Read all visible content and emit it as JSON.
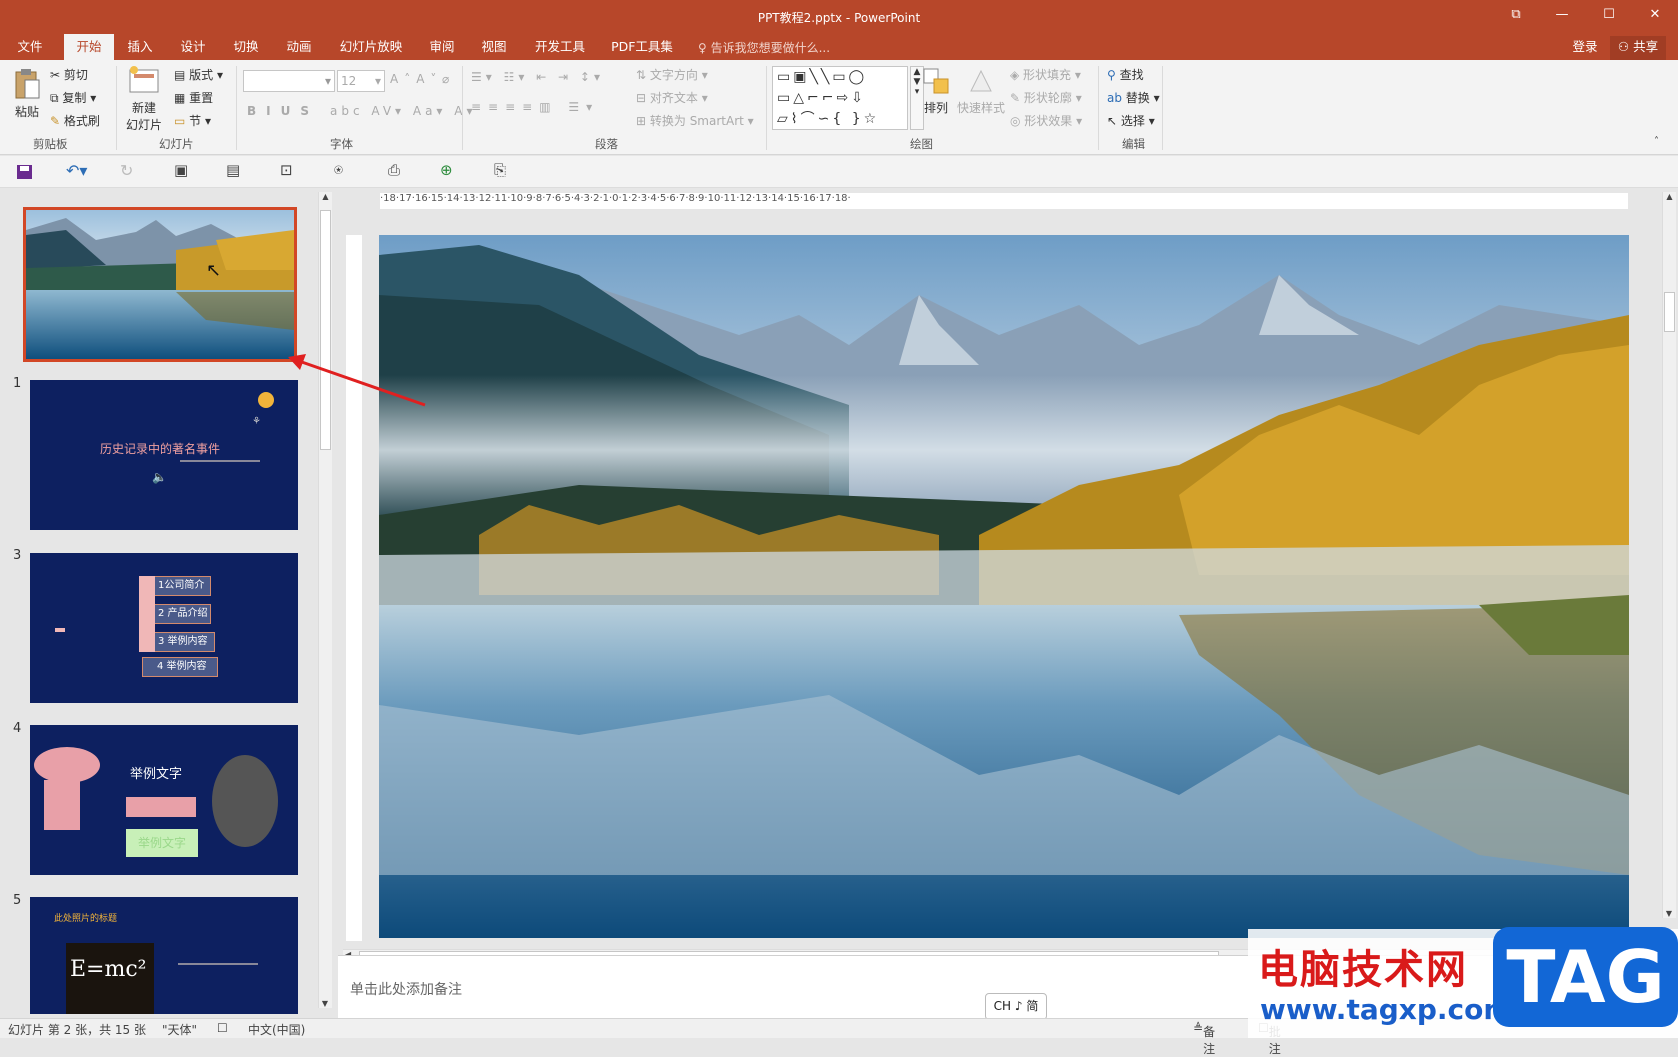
{
  "window": {
    "title": "PPT教程2.pptx - PowerPoint",
    "min": "—",
    "max": "☐",
    "close": "✕",
    "restore": "⧉"
  },
  "tabs": [
    "文件",
    "开始",
    "插入",
    "设计",
    "切换",
    "动画",
    "幻灯片放映",
    "审阅",
    "视图",
    "开发工具",
    "PDF工具集"
  ],
  "tell_me": "告诉我您想要做什么...",
  "account": {
    "login": "登录",
    "share": "共享"
  },
  "ribbon": {
    "clipboard": {
      "label": "剪贴板",
      "paste": "粘贴",
      "cut": "剪切",
      "copy": "复制",
      "format_painter": "格式刷"
    },
    "slides": {
      "label": "幻灯片",
      "new_slide": "新建",
      "new_slide2": "幻灯片",
      "layout": "版式",
      "reset": "重置",
      "section": "节"
    },
    "font": {
      "label": "字体",
      "size": "12"
    },
    "paragraph": {
      "label": "段落",
      "text_direction": "文字方向",
      "align_text": "对齐文本",
      "smartart": "转换为 SmartArt"
    },
    "drawing": {
      "label": "绘图",
      "arrange": "排列",
      "quick_styles": "快速样式",
      "shape_fill": "形状填充",
      "shape_outline": "形状轮廓",
      "shape_effects": "形状效果"
    },
    "editing": {
      "label": "编辑",
      "find": "查找",
      "replace": "替换",
      "select": "选择"
    }
  },
  "thumbnails": [
    {
      "num": "",
      "title": ""
    },
    {
      "num": "1",
      "title": "历史记录中的著名事件"
    },
    {
      "num": "3",
      "items": [
        "1公司简介",
        "2 产品介绍",
        "3 举例内容",
        "4 举例内容"
      ]
    },
    {
      "num": "4",
      "title": "举例文字",
      "sub": "举例文字"
    },
    {
      "num": "5",
      "title": "此处照片的标题",
      "formula": "E=mc²"
    }
  ],
  "ruler_h": "·18·17·16·15·14·13·12·11·10·9·8·7·6·5·4·3·2·1·0·1·2·3·4·5·6·7·8·9·10·11·12·13·14·15·16·17·18·",
  "notes_placeholder": "单击此处添加备注",
  "ime": "CH ♪ 简",
  "status": {
    "slide_info": "幻灯片 第 2 张，共 15 张",
    "theme": "\"天体\"",
    "language": "中文(中国)",
    "notes": "备注",
    "comments": "批注"
  },
  "watermark": {
    "site_name": "电脑技术网",
    "url": "www.tagxp.com",
    "tag": "TAG"
  },
  "colors": {
    "accent": "#b7472a",
    "slide_bg": "#0d2060"
  }
}
